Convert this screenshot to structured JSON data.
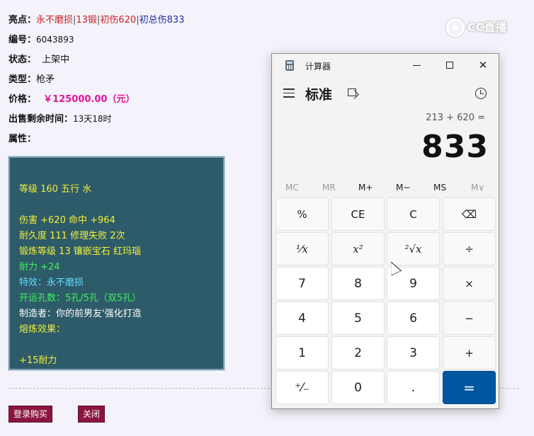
{
  "item": {
    "highlight": {
      "label": "亮点：",
      "parts": [
        "永不磨损",
        "13锻",
        "初伤620",
        "初总伤833"
      ],
      "separator": "|"
    },
    "number": {
      "label": "编号：",
      "value": "6043893"
    },
    "status": {
      "label": "状态：",
      "value": "上架中"
    },
    "type": {
      "label": "类型：",
      "value": "枪矛"
    },
    "price": {
      "label": "价格：",
      "value": "￥125000.00（元）"
    },
    "remaining": {
      "label": "出售剩余时间：",
      "value": "13天18时"
    },
    "attributes": {
      "label": "属性："
    }
  },
  "props_panel": {
    "lines": [
      "等级 160 五行 水",
      "伤害 +620 命中 +964",
      "耐久度 111 修理失败 2次",
      "锻炼等级 13 镶嵌宝石 红玛瑙",
      "耐力 +24",
      "特效：永不磨损",
      "开运孔数：5孔/5孔（双5孔）",
      "制造者：你的前男友'强化打造",
      "熔炼效果：",
      "+15耐力"
    ],
    "colors": {
      "yellow": "#f2ef3a",
      "green": "#3ef05a",
      "cyan": "#66d9ff",
      "white": "#ffffff"
    }
  },
  "buttons": {
    "login_buy": "登录购买",
    "close": "关闭"
  },
  "watermark": {
    "text": "CC直播"
  },
  "calculator": {
    "window_title": "计算器",
    "controls": {
      "minimize": "—",
      "maximize": "☐",
      "close": "✕"
    },
    "mode": "标准",
    "expression": "213 + 620 =",
    "result": "833",
    "memory": [
      "MC",
      "MR",
      "M+",
      "M−",
      "MS",
      "M∨"
    ],
    "keys": [
      [
        "%",
        "CE",
        "C",
        "⌫"
      ],
      [
        "¹⁄x",
        "x²",
        "²√x",
        "÷"
      ],
      [
        "7",
        "8",
        "9",
        "×"
      ],
      [
        "4",
        "5",
        "6",
        "−"
      ],
      [
        "1",
        "2",
        "3",
        "+"
      ],
      [
        "⁺⁄₋",
        "0",
        ".",
        "="
      ]
    ],
    "accent_color": "#00569f"
  }
}
